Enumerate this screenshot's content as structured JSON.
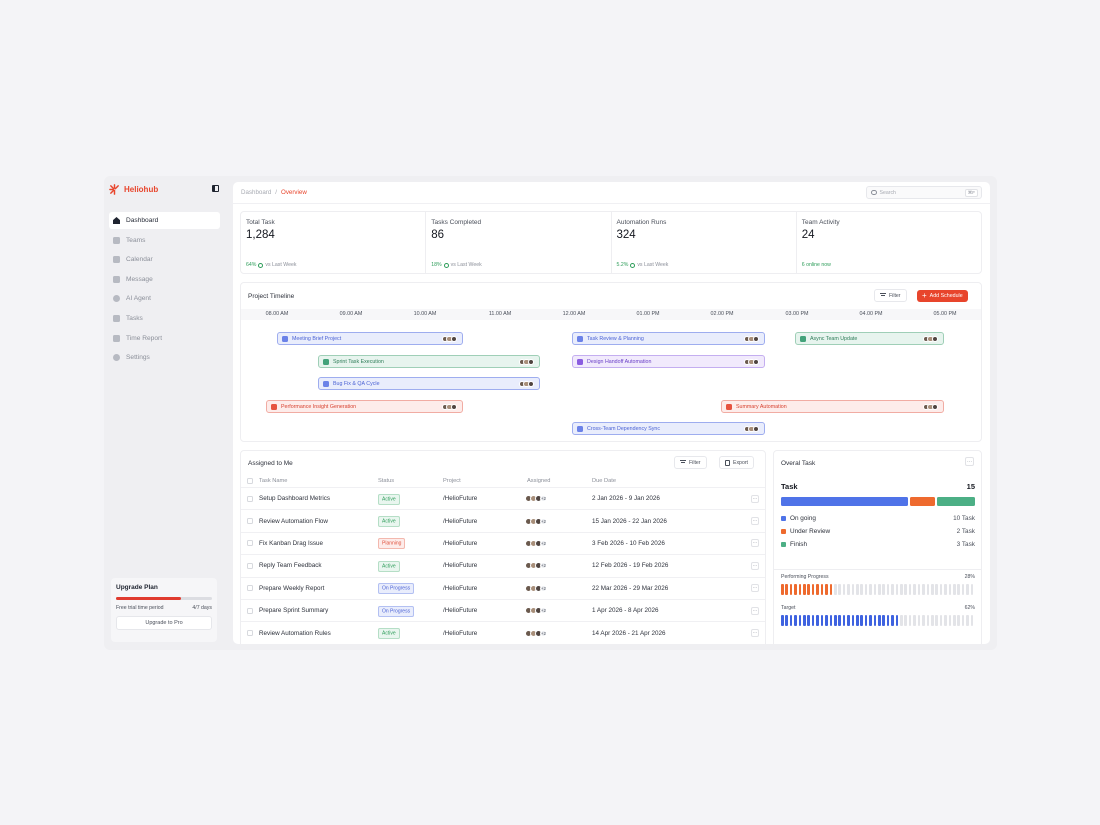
{
  "app": {
    "name": "Heliohub"
  },
  "sidebar": {
    "items": [
      {
        "label": "Dashboard"
      },
      {
        "label": "Teams"
      },
      {
        "label": "Calendar"
      },
      {
        "label": "Message"
      },
      {
        "label": "AI Agent"
      },
      {
        "label": "Tasks"
      },
      {
        "label": "Time Report"
      },
      {
        "label": "Settings"
      }
    ],
    "upgrade": {
      "title": "Upgrade Plan",
      "period_label": "Free trial time period",
      "period_value": "4/7 days",
      "progress": 0.68,
      "button": "Upgrade to Pro"
    }
  },
  "header": {
    "breadcrumb_root": "Dashboard",
    "breadcrumb_sep": "/",
    "breadcrumb_current": "Overview",
    "search_placeholder": "Search",
    "search_shortcut": "⌘F"
  },
  "stats": [
    {
      "label": "Total Task",
      "value": "1,284",
      "change": "64%",
      "suffix": "vs Last Week"
    },
    {
      "label": "Tasks Completed",
      "value": "86",
      "change": "18%",
      "suffix": "vs Last Week"
    },
    {
      "label": "Automation Runs",
      "value": "324",
      "change": "5.2%",
      "suffix": "vs Last Week"
    },
    {
      "label": "Team Activity",
      "value": "24",
      "online": "6 online now"
    }
  ],
  "timeline": {
    "title": "Project Timeline",
    "filter_label": "Filter",
    "add_label": "Add Schedule",
    "times": [
      "08.00 AM",
      "09.00 AM",
      "10.00 AM",
      "11.00 AM",
      "12.00 AM",
      "01.00 PM",
      "02.00 PM",
      "03.00 PM",
      "04.00 PM",
      "05.00 PM"
    ],
    "events": [
      {
        "label": "Meeting Brief Project",
        "color": "blue"
      },
      {
        "label": "Sprint Task Execution",
        "color": "green"
      },
      {
        "label": "Bug Fix & QA Cycle",
        "color": "blue"
      },
      {
        "label": "Performance Insight Generation",
        "color": "red"
      },
      {
        "label": "Task Review & Planning",
        "color": "blue"
      },
      {
        "label": "Design Handoff Automation",
        "color": "purple"
      },
      {
        "label": "Cross-Team Dependency Sync",
        "color": "blue"
      },
      {
        "label": "Async Team Update",
        "color": "green"
      },
      {
        "label": "Summary Automation",
        "color": "red"
      }
    ]
  },
  "assigned": {
    "title": "Assigned to Me",
    "filter_label": "Filter",
    "export_label": "Export",
    "columns": [
      "Task Name",
      "Status",
      "Project",
      "Assigned",
      "Due Date"
    ],
    "rows": [
      {
        "name": "Setup Dashboard Metrics",
        "status": "Active",
        "project": "/HelioFuture",
        "extra": "+2",
        "due": "2 Jan 2026 - 9 Jan 2026"
      },
      {
        "name": "Review Automation Flow",
        "status": "Active",
        "project": "/HelioFuture",
        "extra": "+2",
        "due": "15 Jan 2026 - 22 Jan 2026"
      },
      {
        "name": "Fix Kanban Drag Issue",
        "status": "Planning",
        "project": "/HelioFuture",
        "extra": "+2",
        "due": "3 Feb 2026 - 10 Feb 2026"
      },
      {
        "name": "Reply Team Feedback",
        "status": "Active",
        "project": "/HelioFuture",
        "extra": "+2",
        "due": "12 Feb 2026 - 19 Feb 2026"
      },
      {
        "name": "Prepare Weekly Report",
        "status": "On Progress",
        "project": "/HelioFuture",
        "extra": "+2",
        "due": "22 Mar 2026 - 29 Mar 2026"
      },
      {
        "name": "Prepare Sprint Summary",
        "status": "On Progress",
        "project": "/HelioFuture",
        "extra": "+2",
        "due": "1 Apr 2026 - 8 Apr 2026"
      },
      {
        "name": "Review Automation Rules",
        "status": "Active",
        "project": "/HelioFuture",
        "extra": "+2",
        "due": "14 Apr 2026 - 21 Apr 2026"
      }
    ]
  },
  "overall": {
    "title": "Overal Task",
    "task_label": "Task",
    "task_total": "15",
    "legend": [
      {
        "label": "On going",
        "value": "10 Task",
        "color": "#4f73e8"
      },
      {
        "label": "Under Review",
        "value": "2 Task",
        "color": "#ee6a2e"
      },
      {
        "label": "Finish",
        "value": "3 Task",
        "color": "#4caf85"
      }
    ],
    "performing_label": "Performing Progress",
    "performing_pct": "28%",
    "target_label": "Target",
    "target_pct": "62%"
  },
  "more_glyph": "···"
}
